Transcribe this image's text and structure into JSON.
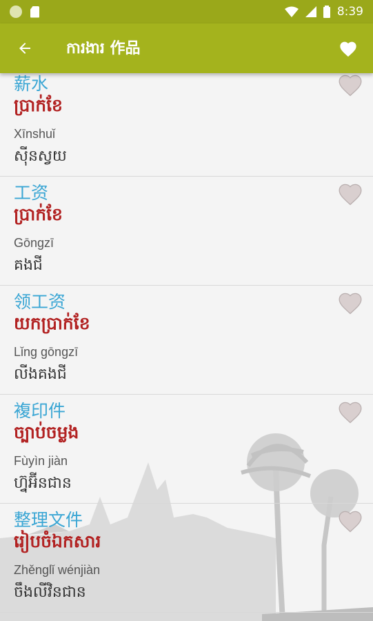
{
  "status_bar": {
    "time": "8:39"
  },
  "header": {
    "title": "ការងារ 作品"
  },
  "colors": {
    "accent": "#a4b31d",
    "chinese": "#3aa6d4",
    "khmer": "#b22222"
  },
  "words": [
    {
      "chinese": "薪水",
      "khmer": "ប្រាក់ខែ",
      "pinyin": "Xīnshuǐ",
      "transliteration": "ស៊ីនស្វយ"
    },
    {
      "chinese": "工资",
      "khmer": "ប្រាក់ខែ",
      "pinyin": "Gōngzī",
      "transliteration": "គងជី"
    },
    {
      "chinese": "领工资",
      "khmer": "យកប្រាក់ខែ",
      "pinyin": "Lǐng gōngzī",
      "transliteration": "លីងគងជី"
    },
    {
      "chinese": "複印件",
      "khmer": "ច្បាប់ចម្លង",
      "pinyin": "Fùyìn jiàn",
      "transliteration": "ហ្វ៊ុអ៊ីនជាន"
    },
    {
      "chinese": "整理文件",
      "khmer": "រៀបចំឯកសារ",
      "pinyin": "Zhěnglǐ wénjiàn",
      "transliteration": "ចឹងលីវិនជាន"
    }
  ]
}
